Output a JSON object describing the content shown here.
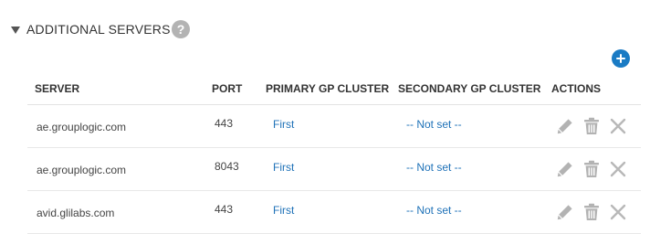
{
  "section": {
    "title": "ADDITIONAL SERVERS",
    "help_icon": "question-mark-icon",
    "add_icon": "plus-circle-icon"
  },
  "table": {
    "columns": [
      "SERVER",
      "PORT",
      "PRIMARY GP CLUSTER",
      "SECONDARY GP CLUSTER",
      "ACTIONS"
    ],
    "rows": [
      {
        "server": "ae.grouplogic.com",
        "port": "443",
        "primary": "First",
        "secondary": "-- Not set --"
      },
      {
        "server": "ae.grouplogic.com",
        "port": "8043",
        "primary": "First",
        "secondary": "-- Not set --"
      },
      {
        "server": "avid.glilabs.com",
        "port": "443",
        "primary": "First",
        "secondary": "-- Not set --"
      }
    ],
    "action_icons": [
      "pencil-icon",
      "trash-icon",
      "close-icon"
    ]
  },
  "colors": {
    "link": "#1f72b8",
    "add_button": "#1a7bc4",
    "icon_gray": "#b3b3b3"
  }
}
